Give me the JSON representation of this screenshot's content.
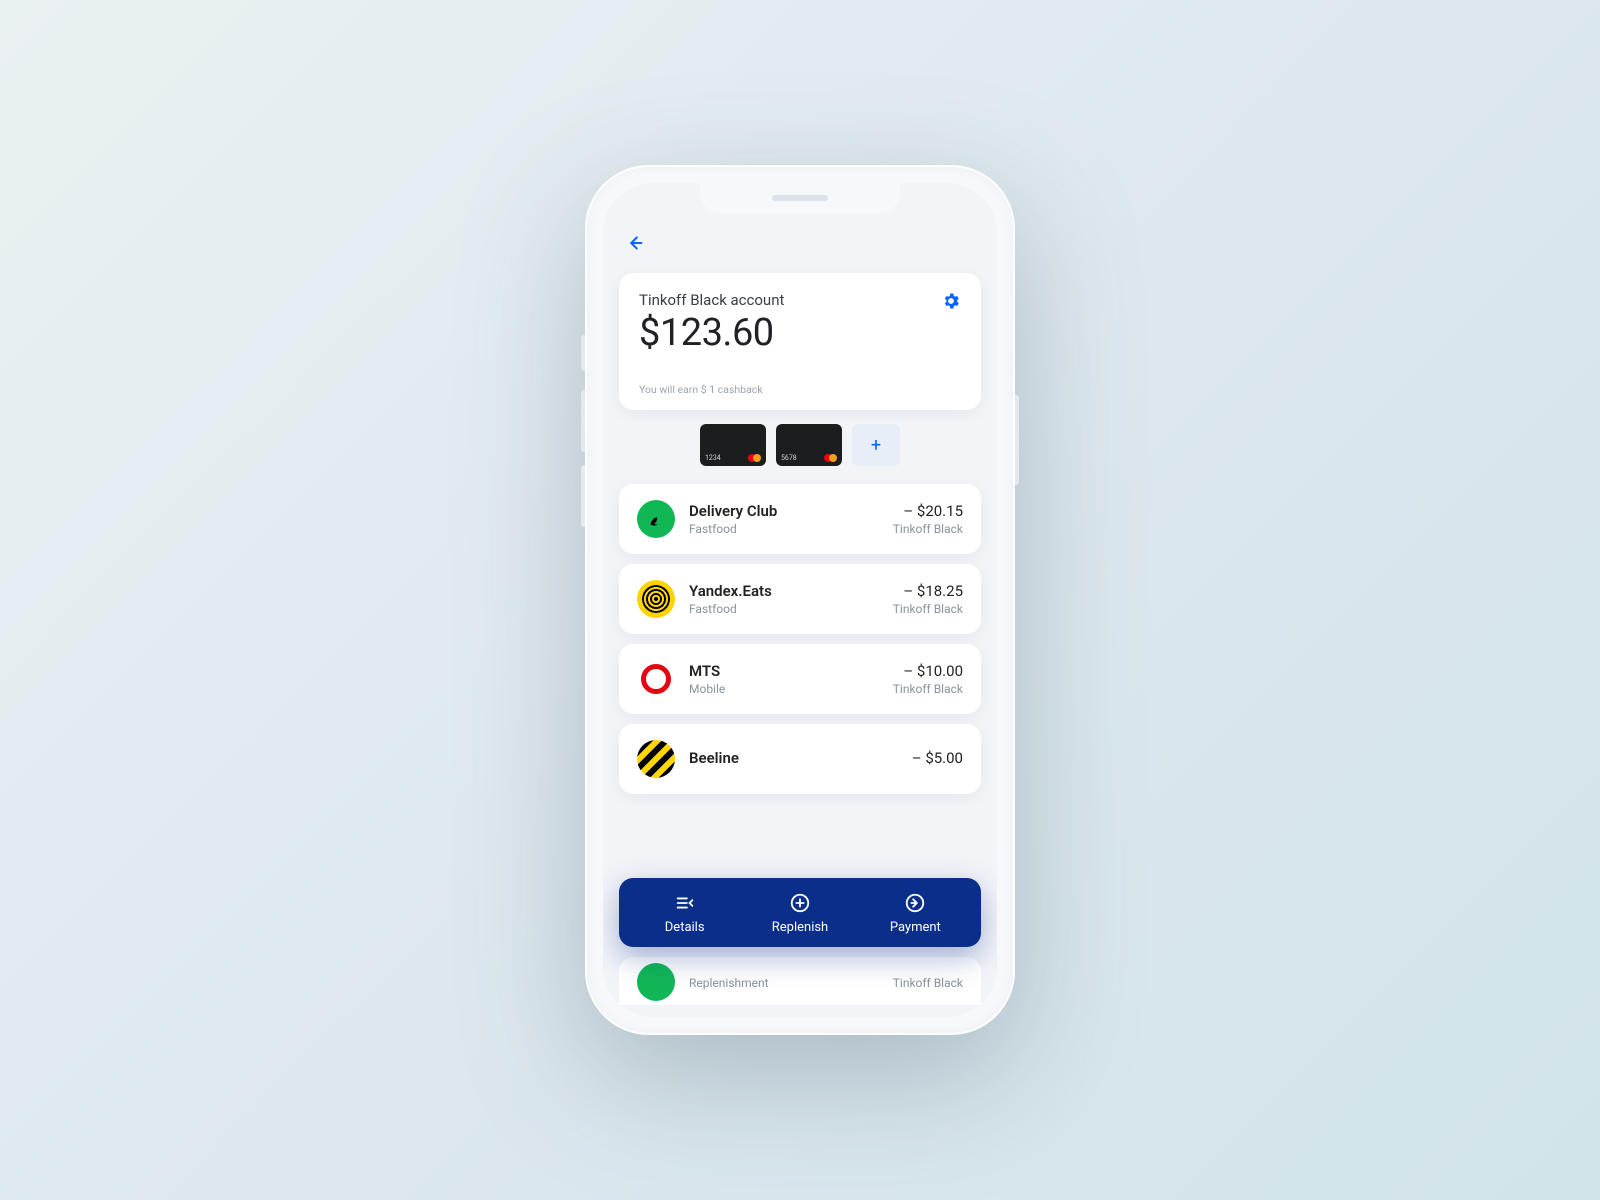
{
  "account": {
    "name": "Tinkoff Black account",
    "balance": "$123.60",
    "cashback_note": "You will earn $ 1 cashback"
  },
  "cards": [
    {
      "last4": "1234"
    },
    {
      "last4": "5678"
    }
  ],
  "add_card_label": "+",
  "transactions": [
    {
      "merchant": "Delivery Club",
      "category": "Fastfood",
      "amount": "– $20.15",
      "source": "Tinkoff Black",
      "icon": "delivery"
    },
    {
      "merchant": "Yandex.Eats",
      "category": "Fastfood",
      "amount": "– $18.25",
      "source": "Tinkoff Black",
      "icon": "yandex"
    },
    {
      "merchant": "MTS",
      "category": "Mobile",
      "amount": "– $10.00",
      "source": "Tinkoff Black",
      "icon": "mts"
    },
    {
      "merchant": "Beeline",
      "category": "",
      "amount": "– $5.00",
      "source": "",
      "icon": "beeline"
    }
  ],
  "peek_transaction": {
    "merchant": "",
    "category": "Replenishment",
    "amount": "",
    "source": "Tinkoff Black",
    "icon": "replenish"
  },
  "actions": {
    "details": "Details",
    "replenish": "Replenish",
    "payment": "Payment"
  },
  "colors": {
    "accent": "#0a63ff",
    "action_bar": "#0a2e8a"
  }
}
